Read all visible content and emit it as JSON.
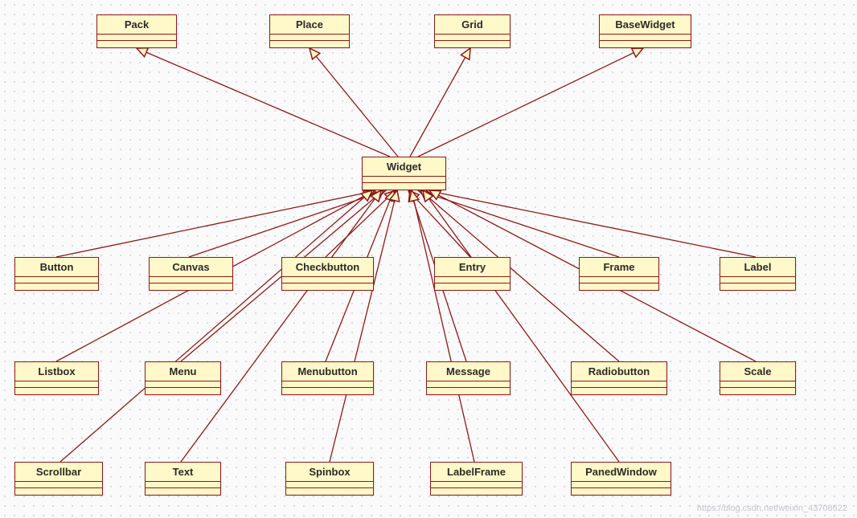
{
  "diagram": {
    "center": {
      "name": "Widget"
    },
    "parents": [
      {
        "name": "Pack"
      },
      {
        "name": "Place"
      },
      {
        "name": "Grid"
      },
      {
        "name": "BaseWidget"
      }
    ],
    "children_row1": [
      {
        "name": "Button"
      },
      {
        "name": "Canvas"
      },
      {
        "name": "Checkbutton"
      },
      {
        "name": "Entry"
      },
      {
        "name": "Frame"
      },
      {
        "name": "Label"
      }
    ],
    "children_row2": [
      {
        "name": "Listbox"
      },
      {
        "name": "Menu"
      },
      {
        "name": "Menubutton"
      },
      {
        "name": "Message"
      },
      {
        "name": "Radiobutton"
      },
      {
        "name": "Scale"
      }
    ],
    "children_row3": [
      {
        "name": "Scrollbar"
      },
      {
        "name": "Text"
      },
      {
        "name": "Spinbox"
      },
      {
        "name": "LabelFrame"
      },
      {
        "name": "PanedWindow"
      }
    ]
  },
  "colors": {
    "box_fill": "#fff8c8",
    "box_border": "#8b1a1a",
    "line": "#8b1a1a"
  },
  "watermark": "https://blog.csdn.net/weixin_43708622"
}
